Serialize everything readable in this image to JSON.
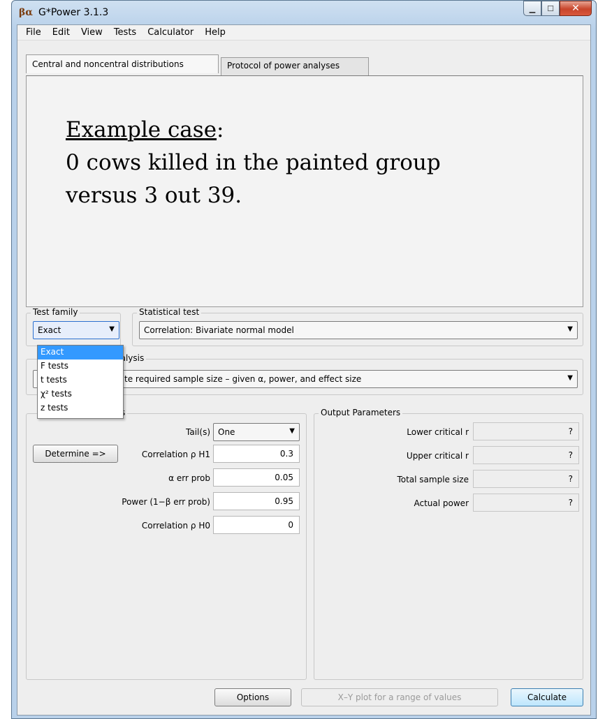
{
  "window": {
    "title": "G*Power 3.1.3",
    "icon_text": "βα"
  },
  "menu": [
    "File",
    "Edit",
    "View",
    "Tests",
    "Calculator",
    "Help"
  ],
  "tabs": [
    "Central and noncentral distributions",
    "Protocol of power analyses"
  ],
  "panel": {
    "heading": "Example case",
    "heading_suffix": ":",
    "line1": "0 cows killed in the painted group",
    "line2": "versus 3 out 39."
  },
  "test_family": {
    "label": "Test family",
    "value": "Exact",
    "options": [
      "Exact",
      "F tests",
      "t tests",
      "χ² tests",
      "z tests"
    ]
  },
  "statistical_test": {
    "label": "Statistical test",
    "value": "Correlation: Bivariate normal model"
  },
  "power_analysis": {
    "label_visible": "nalysis",
    "value_visible": "te required sample size – given α, power, and effect size"
  },
  "input_params": {
    "label_visible": "s",
    "tails_label": "Tail(s)",
    "tails_value": "One",
    "determine_button": "Determine =>",
    "rho_h1_label": "Correlation ρ H1",
    "rho_h1_value": "0.3",
    "alpha_label": "α err prob",
    "alpha_value": "0.05",
    "power_label": "Power (1−β err prob)",
    "power_value": "0.95",
    "rho_h0_label": "Correlation ρ H0",
    "rho_h0_value": "0"
  },
  "output_params": {
    "label": "Output Parameters",
    "rows": [
      {
        "label": "Lower critical r",
        "value": "?"
      },
      {
        "label": "Upper critical r",
        "value": "?"
      },
      {
        "label": "Total sample size",
        "value": "?"
      },
      {
        "label": "Actual power",
        "value": "?"
      }
    ]
  },
  "buttons": {
    "options": "Options",
    "xy_plot": "X–Y plot for a range of values",
    "calculate": "Calculate"
  }
}
